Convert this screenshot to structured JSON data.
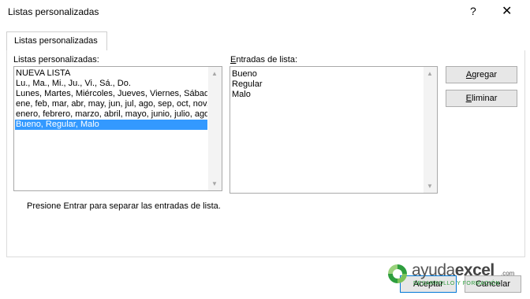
{
  "window": {
    "title": "Listas personalizadas",
    "help_glyph": "?",
    "close_glyph": "✕"
  },
  "tab": {
    "label": "Listas personalizadas"
  },
  "left": {
    "label": "Listas personalizadas:",
    "items": [
      "NUEVA LISTA",
      "Lu., Ma., Mi., Ju., Vi., Sá., Do.",
      "Lunes, Martes, Miércoles, Jueves, Viernes, Sábado, Domingo",
      "ene, feb, mar, abr, may, jun, jul, ago, sep, oct, nov, dic",
      "enero, febrero, marzo, abril, mayo, junio, julio, agosto",
      "Bueno, Regular, Malo"
    ],
    "selected_index": 5
  },
  "right": {
    "label": "Entradas de lista:",
    "entries": [
      "Bueno",
      "Regular",
      "Malo"
    ]
  },
  "buttons": {
    "add": "Agregar",
    "delete": "Eliminar",
    "ok": "Aceptar",
    "cancel": "Cancelar"
  },
  "note": "Presione Entrar para separar las entradas de lista.",
  "watermark": {
    "brand_a": "ayuda",
    "brand_b": "excel",
    "tld": ".com",
    "tagline": "DESARROLLO Y FORMACIÓN"
  },
  "icons": {
    "scroll_up": "▲",
    "scroll_down": "▼"
  },
  "colors": {
    "selection": "#3399ff",
    "logo_green": "#2e9e3e",
    "logo_gray": "#555555"
  }
}
